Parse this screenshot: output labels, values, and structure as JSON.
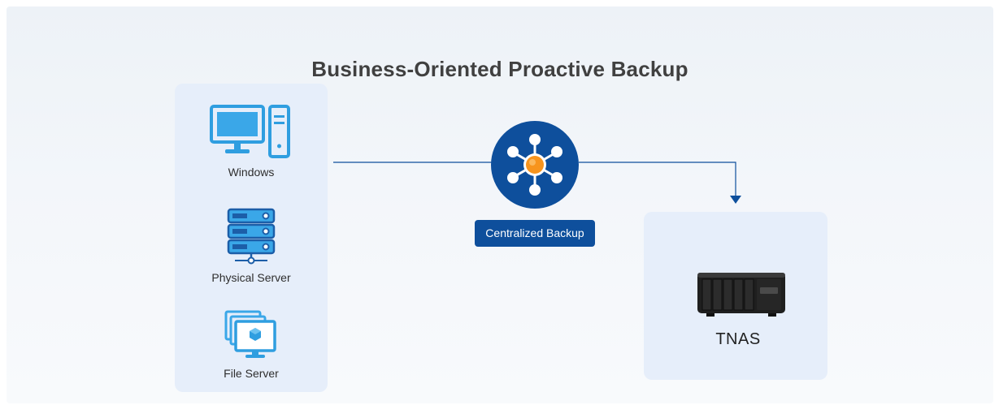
{
  "title": "Business-Oriented Proactive Backup",
  "sources": [
    {
      "label": "Windows",
      "icon": "desktop-computer-icon"
    },
    {
      "label": "Physical Server",
      "icon": "server-rack-icon"
    },
    {
      "label": "File Server",
      "icon": "file-server-icon"
    }
  ],
  "hub": {
    "label": "Centralized Backup",
    "icon": "network-hub-icon"
  },
  "target": {
    "label": "TNAS",
    "icon": "nas-device-icon"
  },
  "colors": {
    "primary": "#0e4f9c",
    "icon_blue": "#2f9ee0",
    "accent_orange": "#f7941d",
    "panel": "#e6eefa"
  }
}
